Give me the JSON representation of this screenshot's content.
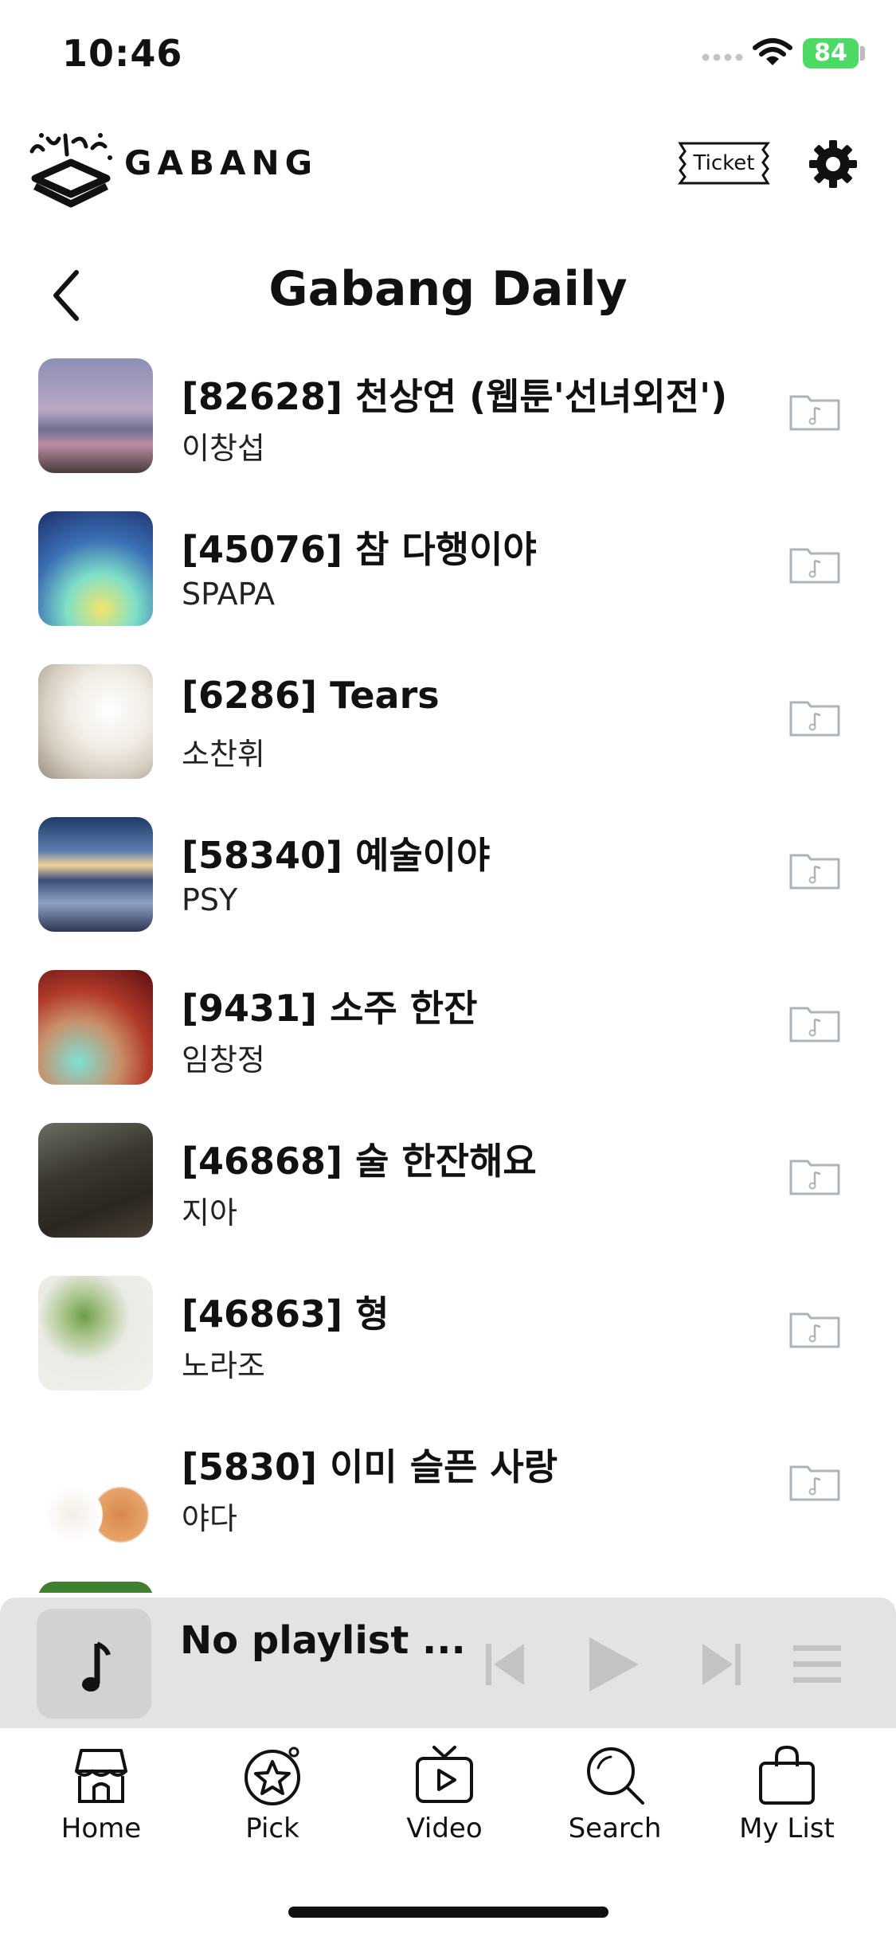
{
  "status": {
    "time": "10:46",
    "battery": "84"
  },
  "header": {
    "brand": "GABANG",
    "ticket_label": "Ticket"
  },
  "page": {
    "title": "Gabang Daily"
  },
  "songs": [
    {
      "title": "[82628] 천상연 (웹툰'선녀외전')",
      "artist": "이창섭"
    },
    {
      "title": "[45076] 참 다행이야",
      "artist": "SPAPA"
    },
    {
      "title": "[6286] Tears",
      "artist": "소찬휘"
    },
    {
      "title": "[58340] 예술이야",
      "artist": "PSY"
    },
    {
      "title": "[9431] 소주 한잔",
      "artist": "임창정"
    },
    {
      "title": "[46868] 술 한잔해요",
      "artist": "지아"
    },
    {
      "title": "[46863] 형",
      "artist": "노라조"
    },
    {
      "title": "[5830] 이미 슬픈 사랑",
      "artist": "야다"
    }
  ],
  "player": {
    "now_playing": "No playlist ..."
  },
  "tabs": [
    {
      "label": "Home",
      "icon": "home-icon"
    },
    {
      "label": "Pick",
      "icon": "star-icon"
    },
    {
      "label": "Video",
      "icon": "tv-icon"
    },
    {
      "label": "Search",
      "icon": "search-icon"
    },
    {
      "label": "My List",
      "icon": "bag-icon"
    }
  ],
  "colors": {
    "battery": "#4cd964",
    "player_bg": "#e3e3e3",
    "folder_icon": "#aab4bb"
  }
}
